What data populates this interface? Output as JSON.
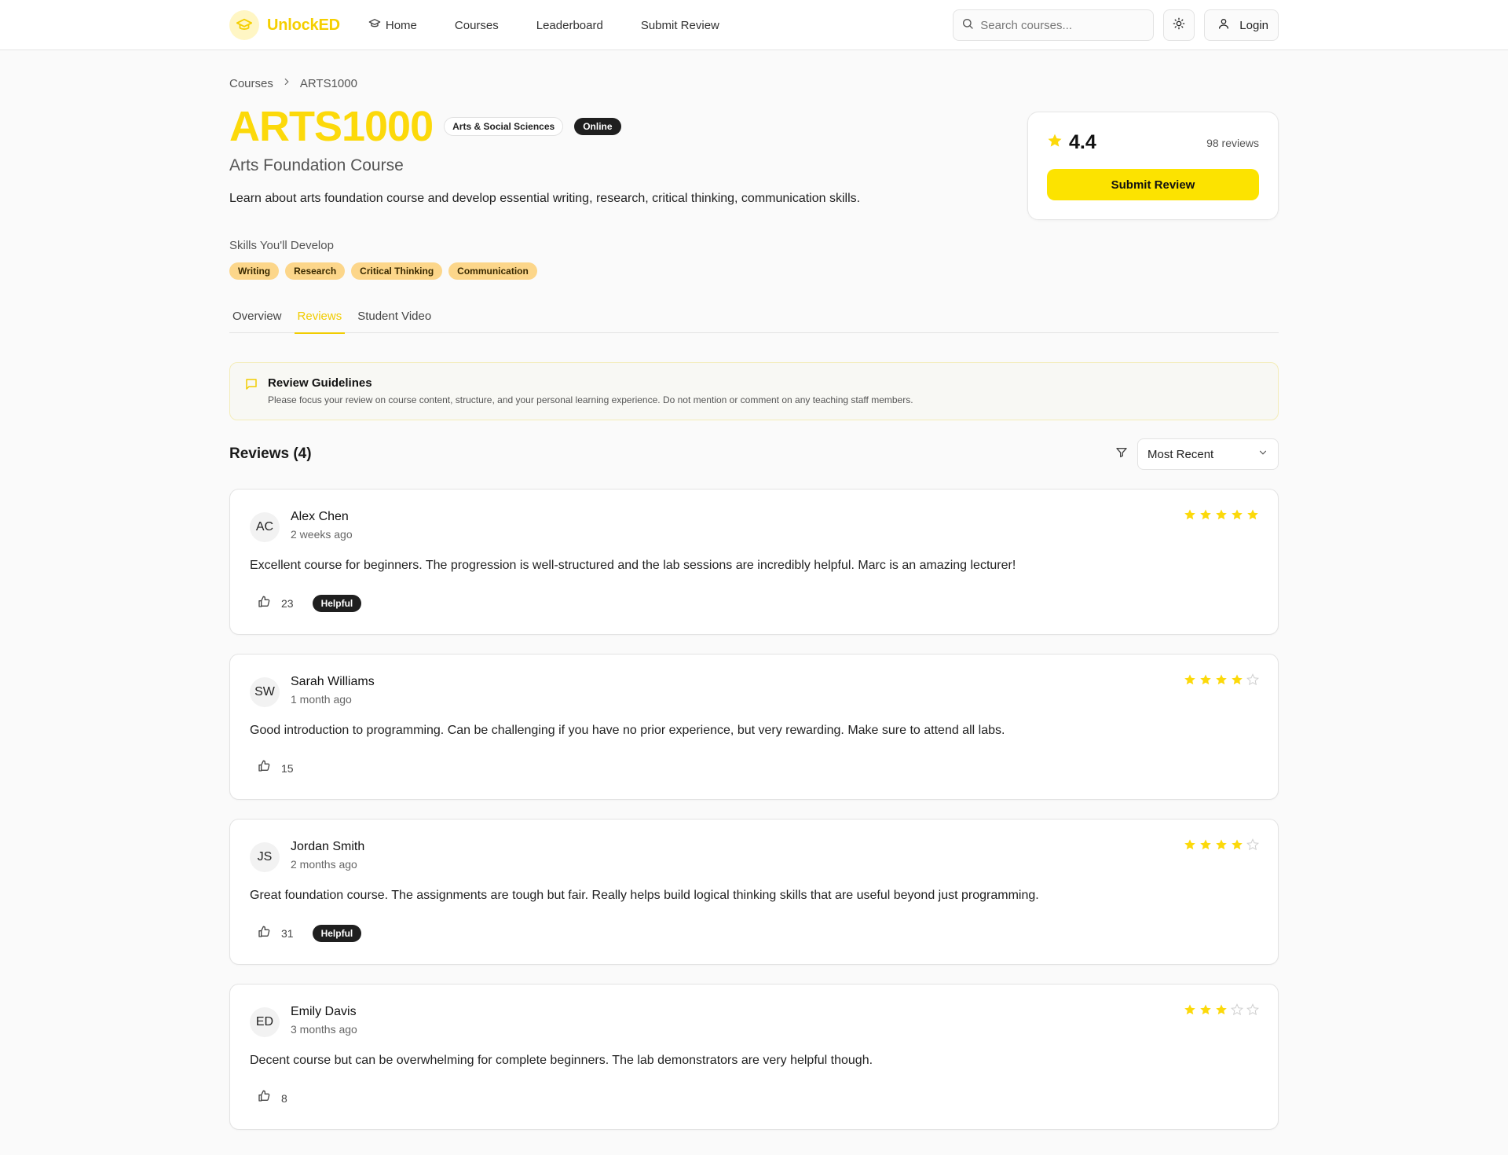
{
  "header": {
    "brand": "UnlockED",
    "nav": [
      {
        "label": "Home",
        "icon": "graduation-cap-icon"
      },
      {
        "label": "Courses"
      },
      {
        "label": "Leaderboard"
      },
      {
        "label": "Submit Review"
      }
    ],
    "search_placeholder": "Search courses...",
    "login_label": "Login"
  },
  "breadcrumb": {
    "root": "Courses",
    "current": "ARTS1000"
  },
  "course": {
    "code": "ARTS1000",
    "faculty": "Arts & Social Sciences",
    "mode": "Online",
    "name": "Arts Foundation Course",
    "description": "Learn about arts foundation course and develop essential writing, research, critical thinking, communication skills.",
    "skills_label": "Skills You'll Develop",
    "skills": [
      "Writing",
      "Research",
      "Critical Thinking",
      "Communication"
    ]
  },
  "rating_card": {
    "rating": "4.4",
    "reviews": "98 reviews",
    "submit_label": "Submit Review"
  },
  "tabs": [
    {
      "label": "Overview",
      "active": false
    },
    {
      "label": "Reviews",
      "active": true
    },
    {
      "label": "Student Video",
      "active": false
    }
  ],
  "guidelines": {
    "title": "Review Guidelines",
    "text": "Please focus your review on course content, structure, and your personal learning experience. Do not mention or comment on any teaching staff members."
  },
  "reviews_section": {
    "title": "Reviews (4)",
    "sort_value": "Most Recent"
  },
  "reviews": [
    {
      "initials": "AC",
      "name": "Alex Chen",
      "time": "2 weeks ago",
      "rating": 5,
      "text": "Excellent course for beginners. The progression is well-structured and the lab sessions are incredibly helpful. Marc is an amazing lecturer!",
      "likes": "23",
      "badge": "Helpful"
    },
    {
      "initials": "SW",
      "name": "Sarah Williams",
      "time": "1 month ago",
      "rating": 4,
      "text": "Good introduction to programming. Can be challenging if you have no prior experience, but very rewarding. Make sure to attend all labs.",
      "likes": "15",
      "badge": ""
    },
    {
      "initials": "JS",
      "name": "Jordan Smith",
      "time": "2 months ago",
      "rating": 4,
      "text": "Great foundation course. The assignments are tough but fair. Really helps build logical thinking skills that are useful beyond just programming.",
      "likes": "31",
      "badge": "Helpful"
    },
    {
      "initials": "ED",
      "name": "Emily Davis",
      "time": "3 months ago",
      "rating": 3,
      "text": "Decent course but can be overwhelming for complete beginners. The lab demonstrators are very helpful though.",
      "likes": "8",
      "badge": ""
    }
  ],
  "colors": {
    "accent": "#fcd90a",
    "button": "#fce300",
    "dark_badge": "#1f1f1f",
    "skill": "#fcd68a"
  }
}
